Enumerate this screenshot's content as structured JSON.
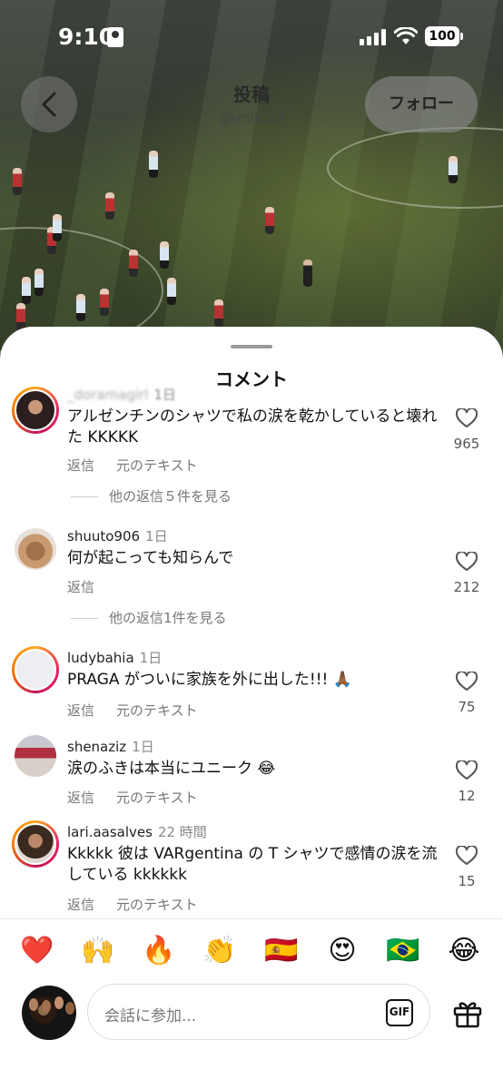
{
  "status": {
    "time": "9:10",
    "battery": "100"
  },
  "header": {
    "title": "投稿",
    "username": "gamix.o7",
    "follow_label": "フォロー"
  },
  "sheet": {
    "title": "コメント"
  },
  "comments": [
    {
      "username": "_doramagirl",
      "time": "1日",
      "text": "アルゼンチンのシャツで私の涙を乾かしていると壊れた KKKKK",
      "actions": [
        "返信",
        "元のテキスト"
      ],
      "replies": "他の返信５件を見る",
      "likes": "965"
    },
    {
      "username": "shuuto906",
      "time": "1日",
      "text": "何が起こっても知らんで",
      "actions": [
        "返信"
      ],
      "replies": "他の返信1件を見る",
      "likes": "212"
    },
    {
      "username": "ludybahia",
      "time": "1日",
      "text": "PRAGA がついに家族を外に出した!!! 🙏🏾",
      "actions": [
        "返信",
        "元のテキスト"
      ],
      "likes": "75"
    },
    {
      "username": "shenaziz",
      "time": "1日",
      "text": "涙のふきは本当にユニーク 😂",
      "actions": [
        "返信",
        "元のテキスト"
      ],
      "likes": "12"
    },
    {
      "username": "lari.aasalves",
      "time": "22 時間",
      "text": "Kkkkk 彼は VARgentina の T シャツで感情の涙を流している kkkkkk",
      "actions": [
        "返信",
        "元のテキスト"
      ],
      "likes": "15"
    }
  ],
  "emoji_bar": [
    "❤️",
    "🙌",
    "🔥",
    "👏",
    "🇪🇸",
    "😍",
    "🇧🇷",
    "😂"
  ],
  "input": {
    "placeholder": "会話に参加...",
    "gif_label": "GIF"
  },
  "icons": {
    "back": "chevron-left-icon",
    "like": "heart-outline-icon",
    "gift": "gift-icon"
  },
  "colors": {
    "story_ring_start": "#f9a825",
    "story_ring_end": "#e91e63"
  }
}
